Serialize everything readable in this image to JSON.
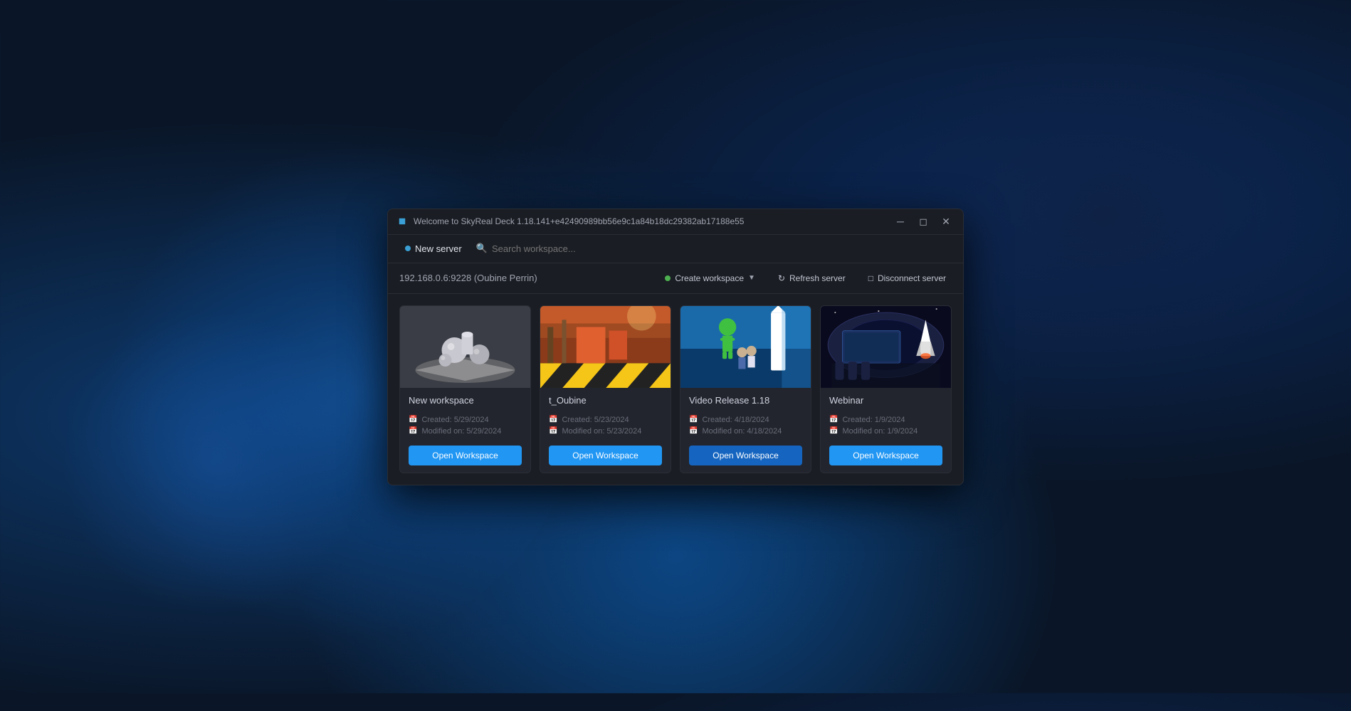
{
  "window": {
    "title": "Welcome to SkyReal Deck 1.18.141+e42490989bb56e9c1a84b18dc29382ab17188e55",
    "minimize_label": "minimize",
    "maximize_label": "maximize",
    "close_label": "close"
  },
  "toolbar": {
    "new_server_label": "New server",
    "search_placeholder": "Search workspace..."
  },
  "server": {
    "name": "192.168.0.6:9228 (Oubine Perrin)",
    "create_workspace_label": "Create workspace",
    "refresh_server_label": "Refresh server",
    "disconnect_server_label": "Disconnect server"
  },
  "workspaces": [
    {
      "id": "new-workspace",
      "title": "New workspace",
      "created": "Created: 5/29/2024",
      "modified": "Modified on: 5/29/2024",
      "open_label": "Open Workspace",
      "thumbnail_type": "new-workspace"
    },
    {
      "id": "t-oubine",
      "title": "t_Oubine",
      "created": "Created: 5/23/2024",
      "modified": "Modified on: 5/23/2024",
      "open_label": "Open Workspace",
      "thumbnail_type": "t-oubine"
    },
    {
      "id": "video-release",
      "title": "Video Release 1.18",
      "created": "Created: 4/18/2024",
      "modified": "Modified on: 4/18/2024",
      "open_label": "Open Workspace",
      "thumbnail_type": "video-release",
      "hovered": true
    },
    {
      "id": "webinar",
      "title": "Webinar",
      "created": "Created: 1/9/2024",
      "modified": "Modified on: 1/9/2024",
      "open_label": "Open Workspace",
      "thumbnail_type": "webinar"
    }
  ]
}
